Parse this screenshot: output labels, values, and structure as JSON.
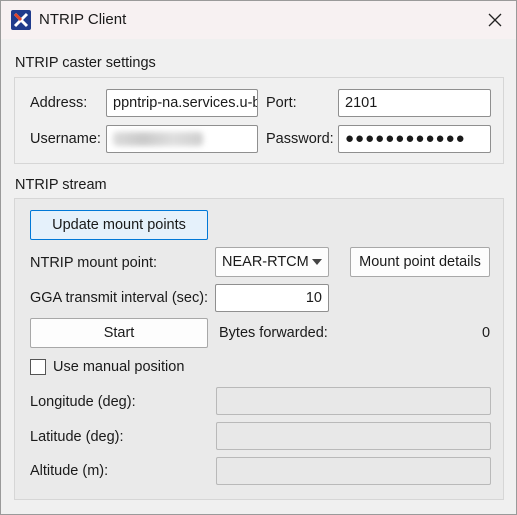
{
  "window": {
    "title": "NTRIP Client"
  },
  "caster": {
    "section_label": "NTRIP caster settings",
    "address_label": "Address:",
    "address_value": "ppntrip-na.services.u-blox.com",
    "port_label": "Port:",
    "port_value": "2101",
    "username_label": "Username:",
    "password_label": "Password:",
    "password_value": "●●●●●●●●●●●●"
  },
  "stream": {
    "section_label": "NTRIP stream",
    "update_button": "Update mount points",
    "mount_label": "NTRIP mount point:",
    "mount_value": "NEAR-RTCM",
    "mount_details_button": "Mount point details",
    "gga_label": "GGA transmit interval (sec):",
    "gga_value": "10",
    "start_button": "Start",
    "bytes_label": "Bytes forwarded:",
    "bytes_value": "0",
    "manual_label": "Use manual position",
    "manual_checked": false,
    "longitude_label": "Longitude (deg):",
    "latitude_label": "Latitude (deg):",
    "altitude_label": "Altitude (m):"
  },
  "icons": {
    "app": "app-logo-icon",
    "close": "close-icon",
    "dropdown": "chevron-down-icon"
  },
  "colors": {
    "primary_button_border": "#0078d7",
    "primary_button_bg": "#e5f1fb",
    "app_icon_bg": "#1f3b8c"
  }
}
